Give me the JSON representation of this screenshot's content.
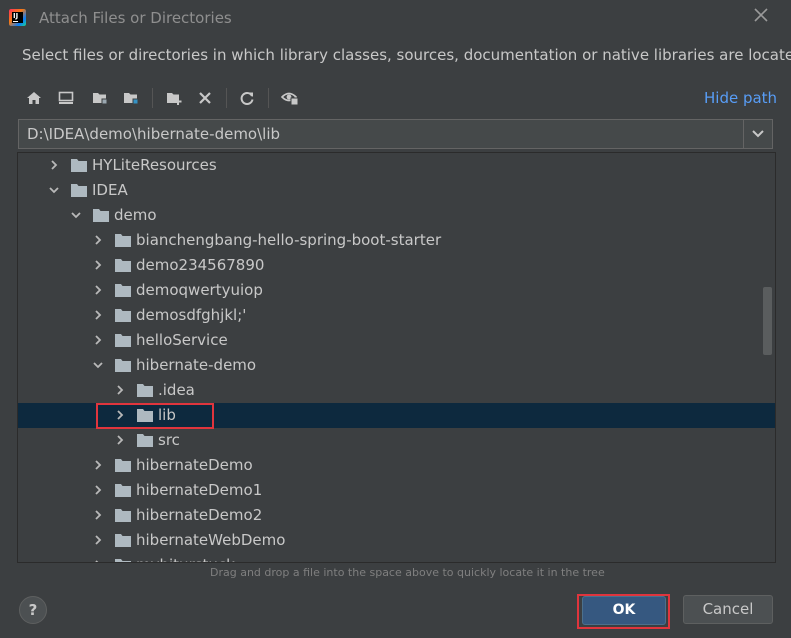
{
  "window": {
    "title": "Attach Files or Directories",
    "close_icon": "close-icon"
  },
  "description": "Select files or directories in which library classes, sources, documentation or native libraries are located",
  "toolbar": {
    "buttons": [
      {
        "name": "home-icon"
      },
      {
        "name": "desktop-icon"
      },
      {
        "name": "project-folder-icon"
      },
      {
        "name": "module-folder-icon"
      },
      {
        "name": "new-folder-icon"
      },
      {
        "name": "delete-icon"
      },
      {
        "name": "refresh-icon"
      },
      {
        "name": "show-hidden-icon"
      }
    ],
    "hide_path_label": "Hide path"
  },
  "path": {
    "value": "D:\\IDEA\\demo\\hibernate-demo\\lib"
  },
  "tree": {
    "rows": [
      {
        "label": "HYLiteResources",
        "depth": 0,
        "expanded": false,
        "selected": false
      },
      {
        "label": "IDEA",
        "depth": 0,
        "expanded": true,
        "selected": false
      },
      {
        "label": "demo",
        "depth": 1,
        "expanded": true,
        "selected": false
      },
      {
        "label": "bianchengbang-hello-spring-boot-starter",
        "depth": 2,
        "expanded": false,
        "selected": false
      },
      {
        "label": "demo234567890",
        "depth": 2,
        "expanded": false,
        "selected": false
      },
      {
        "label": "demoqwertyuiop",
        "depth": 2,
        "expanded": false,
        "selected": false
      },
      {
        "label": "demosdfghjkl;'",
        "depth": 2,
        "expanded": false,
        "selected": false
      },
      {
        "label": "helloService",
        "depth": 2,
        "expanded": false,
        "selected": false
      },
      {
        "label": "hibernate-demo",
        "depth": 2,
        "expanded": true,
        "selected": false
      },
      {
        "label": ".idea",
        "depth": 3,
        "expanded": false,
        "selected": false
      },
      {
        "label": "lib",
        "depth": 3,
        "expanded": false,
        "selected": true
      },
      {
        "label": "src",
        "depth": 3,
        "expanded": false,
        "selected": false
      },
      {
        "label": "hibernateDemo",
        "depth": 2,
        "expanded": false,
        "selected": false
      },
      {
        "label": "hibernateDemo1",
        "depth": 2,
        "expanded": false,
        "selected": false
      },
      {
        "label": "hibernateDemo2",
        "depth": 2,
        "expanded": false,
        "selected": false
      },
      {
        "label": "hibernateWebDemo",
        "depth": 2,
        "expanded": false,
        "selected": false
      },
      {
        "label": "mybiturstuck",
        "depth": 2,
        "expanded": false,
        "selected": false
      }
    ]
  },
  "hint": "Drag and drop a file into the space above to quickly locate it in the tree",
  "buttons": {
    "help": "?",
    "ok": "OK",
    "cancel": "Cancel"
  },
  "colors": {
    "background": "#3c3f41",
    "selection": "#0d293e",
    "link": "#589df6",
    "highlight": "#e0353d",
    "ok_button": "#365880"
  }
}
